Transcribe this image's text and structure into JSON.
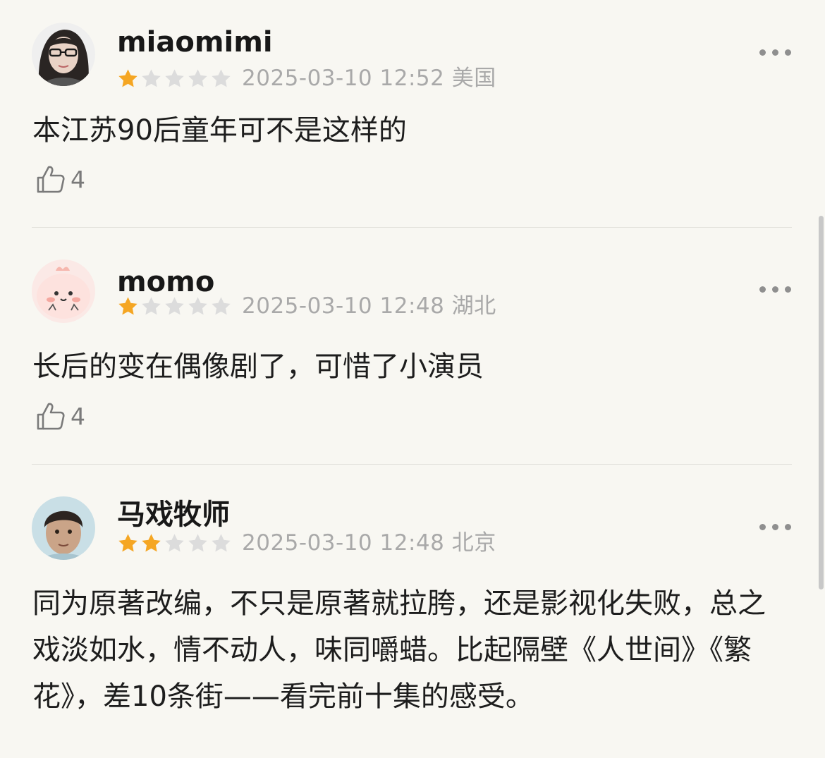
{
  "comments": [
    {
      "username": "miaomimi",
      "rating": 1,
      "meta": "2025-03-10 12:52 美国",
      "content": "本江苏90后童年可不是这样的",
      "likes": "4",
      "avatar_icon": "woman-glasses-avatar"
    },
    {
      "username": "momo",
      "rating": 1,
      "meta": "2025-03-10 12:48 湖北",
      "content": "长后的变在偶像剧了，可惜了小演员",
      "likes": "4",
      "avatar_icon": "pink-cartoon-avatar"
    },
    {
      "username": "马戏牧师",
      "rating": 2,
      "meta": "2025-03-10 12:48 北京",
      "content": "同为原著改编，不只是原著就拉胯，还是影视化失败，总之戏淡如水，情不动人，味同嚼蜡。比起隔壁《人世间》《繁花》，差10条街——看完前十集的感受。",
      "avatar_icon": "child-photo-avatar"
    }
  ],
  "colors": {
    "star_filled": "#f5a623",
    "star_empty": "#dcdcdc",
    "background": "#f8f7f2"
  }
}
